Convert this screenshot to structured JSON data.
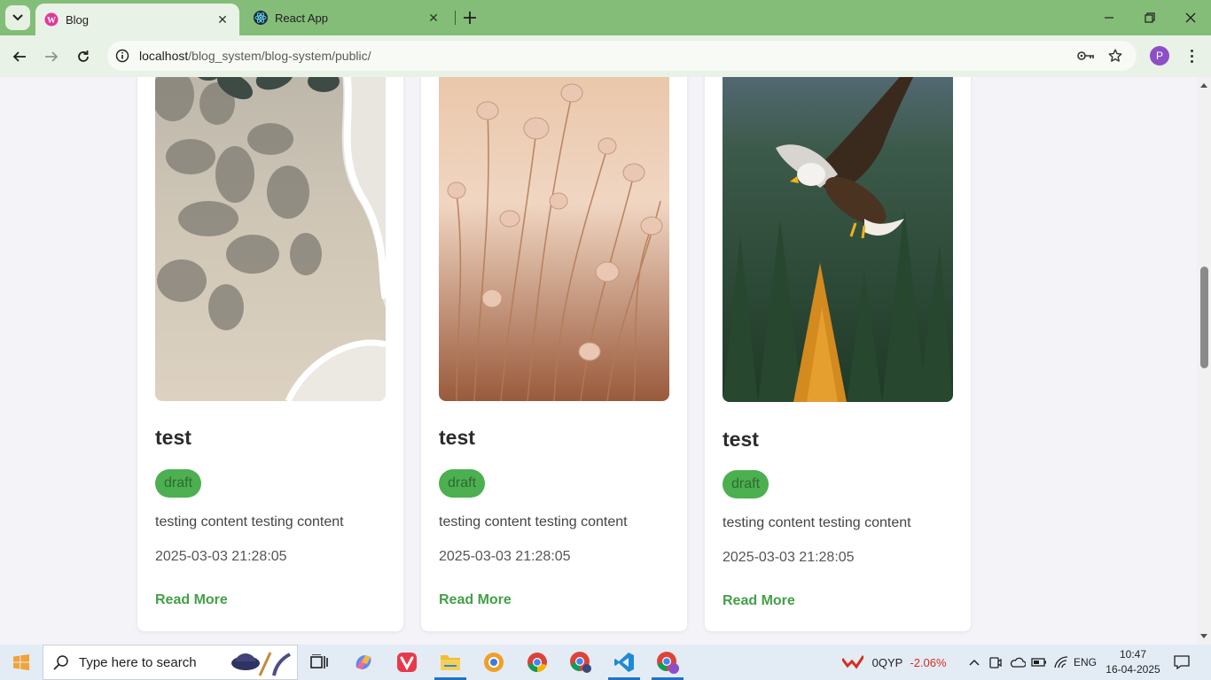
{
  "browser": {
    "tabs": [
      {
        "title": "Blog",
        "favicon": "wordpress-icon",
        "active": true
      },
      {
        "title": "React App",
        "favicon": "react-icon",
        "active": false
      }
    ],
    "url_host": "localhost",
    "url_path": "/blog_system/blog-system/public/",
    "profile_initial": "P",
    "theme_color": "#84bd78"
  },
  "posts": [
    {
      "title": "test",
      "status": "draft",
      "excerpt": "testing content testing content",
      "date": "2025-03-03 21:28:05",
      "read_more": "Read More",
      "image": "beach-shadow-image"
    },
    {
      "title": "test",
      "status": "draft",
      "excerpt": "testing content testing content",
      "date": "2025-03-03 21:28:05",
      "read_more": "Read More",
      "image": "dry-grass-flowers-image"
    },
    {
      "title": "test",
      "status": "draft",
      "excerpt": "testing content testing content",
      "date": "2025-03-03 21:28:05",
      "read_more": "Read More",
      "image": "flying-eagle-image"
    }
  ],
  "colors": {
    "badge": "#4caf50",
    "link": "#43a047"
  },
  "taskbar": {
    "search_placeholder": "Type here to search",
    "stock_ticker": "0QYP",
    "stock_change": "-2.06%",
    "language": "ENG",
    "time": "10:47",
    "date": "16-04-2025"
  }
}
